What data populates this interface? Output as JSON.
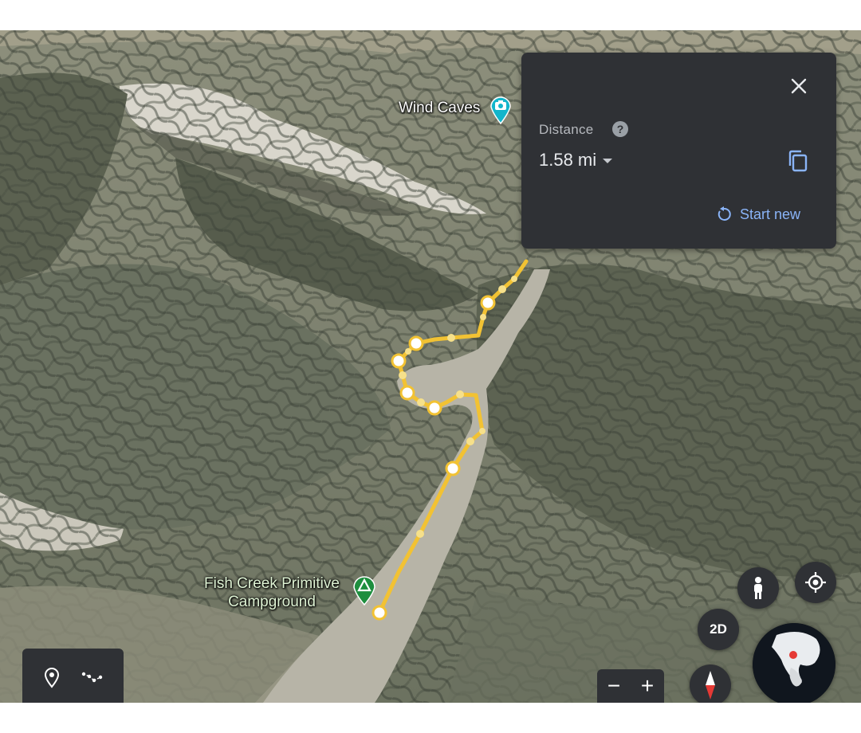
{
  "map": {
    "places": {
      "wind_caves": "Wind Caves",
      "campground_line1": "Fish Creek Primitive",
      "campground_line2": "Campground"
    },
    "route_color": "#f2c233",
    "icons": [
      "camera-pin-icon",
      "campground-pin-icon"
    ]
  },
  "measure_panel": {
    "distance_label": "Distance",
    "distance_value": "1.58 mi",
    "start_new_label": "Start new",
    "icons": [
      "close-icon",
      "help-icon",
      "copy-icon",
      "restart-icon",
      "caret-down-icon"
    ]
  },
  "toolbar": {
    "icons": [
      "location-pin-icon",
      "measure-path-icon"
    ]
  },
  "controls": {
    "view_toggle_label": "2D",
    "zoom_out_label": "−",
    "zoom_in_label": "+",
    "icons": [
      "pegman-icon",
      "my-location-icon",
      "compass-icon",
      "globe-icon"
    ]
  },
  "colors": {
    "panel_bg": "#2f3135",
    "accent": "#8ab4f8",
    "route": "#f2c233"
  }
}
